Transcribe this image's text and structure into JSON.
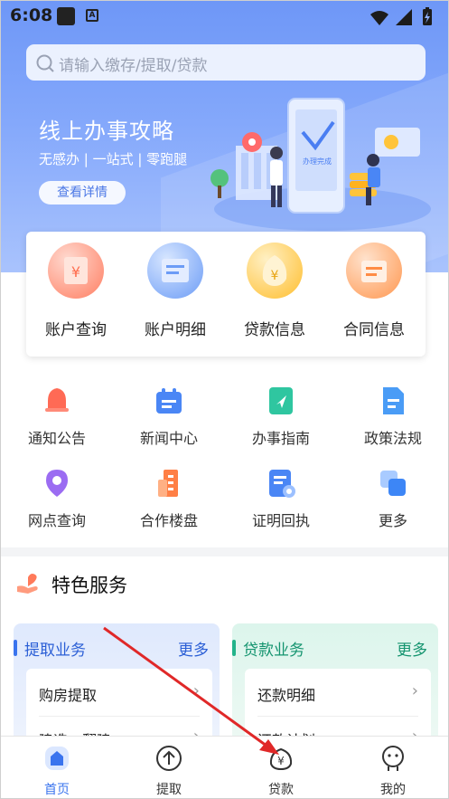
{
  "status_bar": {
    "time": "6:08",
    "badge": "A"
  },
  "search": {
    "placeholder": "请输入缴存/提取/贷款"
  },
  "banner": {
    "title": "线上办事攻略",
    "subtitle": "无感办 | 一站式 | 零跑腿",
    "button": "查看详情",
    "phone_text": "办理完成"
  },
  "quick_actions": [
    {
      "label": "账户查询",
      "icon": "account-query-icon"
    },
    {
      "label": "账户明细",
      "icon": "account-detail-icon"
    },
    {
      "label": "贷款信息",
      "icon": "loan-info-icon"
    },
    {
      "label": "合同信息",
      "icon": "contract-info-icon"
    }
  ],
  "services": [
    {
      "label": "通知公告",
      "icon": "bell-icon"
    },
    {
      "label": "新闻中心",
      "icon": "news-icon"
    },
    {
      "label": "办事指南",
      "icon": "guide-icon"
    },
    {
      "label": "政策法规",
      "icon": "policy-icon"
    },
    {
      "label": "网点查询",
      "icon": "location-icon"
    },
    {
      "label": "合作楼盘",
      "icon": "building-icon"
    },
    {
      "label": "证明回执",
      "icon": "certificate-icon"
    },
    {
      "label": "更多",
      "icon": "more-icon"
    }
  ],
  "featured": {
    "title": "特色服务",
    "panels": [
      {
        "title": "提取业务",
        "more": "更多",
        "items": [
          "购房提取",
          "建造、翻建"
        ],
        "accent": "#3a74ee"
      },
      {
        "title": "贷款业务",
        "more": "更多",
        "items": [
          "还款明细",
          "还款计划"
        ],
        "accent": "#22b38a"
      }
    ]
  },
  "bottom_nav": [
    {
      "label": "首页",
      "icon": "home-icon",
      "active": true
    },
    {
      "label": "提取",
      "icon": "withdraw-icon",
      "active": false
    },
    {
      "label": "贷款",
      "icon": "loan-icon",
      "active": false
    },
    {
      "label": "我的",
      "icon": "profile-icon",
      "active": false
    }
  ],
  "colors": {
    "primary": "#3a74ee",
    "loan_green": "#22b38a",
    "annotation_arrow": "#e02828"
  }
}
